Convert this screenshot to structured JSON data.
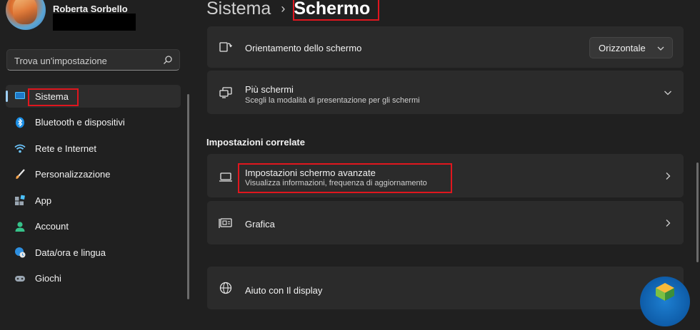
{
  "profile": {
    "name": "Roberta Sorbello"
  },
  "search": {
    "placeholder": "Trova un'impostazione"
  },
  "sidebar": {
    "items": [
      {
        "label": "Sistema",
        "icon": "monitor-icon",
        "active": true
      },
      {
        "label": "Bluetooth e dispositivi",
        "icon": "bluetooth-icon"
      },
      {
        "label": "Rete e Internet",
        "icon": "wifi-icon"
      },
      {
        "label": "Personalizzazione",
        "icon": "brush-icon"
      },
      {
        "label": "App",
        "icon": "apps-icon"
      },
      {
        "label": "Account",
        "icon": "person-icon"
      },
      {
        "label": "Data/ora e lingua",
        "icon": "globe-clock-icon"
      },
      {
        "label": "Giochi",
        "icon": "gamepad-icon"
      }
    ]
  },
  "breadcrumb": {
    "parent": "Sistema",
    "separator": "›",
    "current": "Schermo"
  },
  "cards": {
    "orientation": {
      "title": "Orientamento dello schermo",
      "value": "Orizzontale"
    },
    "multiple": {
      "title": "Più schermi",
      "subtitle": "Scegli la modalità di presentazione per gli schermi"
    },
    "advanced": {
      "title": "Impostazioni schermo avanzate",
      "subtitle": "Visualizza informazioni, frequenza di aggiornamento"
    },
    "graphics": {
      "title": "Grafica"
    },
    "help": {
      "title": "Aiuto con Il display"
    }
  },
  "related": {
    "title": "Impostazioni correlate"
  },
  "colors": {
    "accent": "#9fd0f7",
    "highlight": "#e0161e",
    "background": "#202020",
    "card": "#2b2b2b"
  }
}
